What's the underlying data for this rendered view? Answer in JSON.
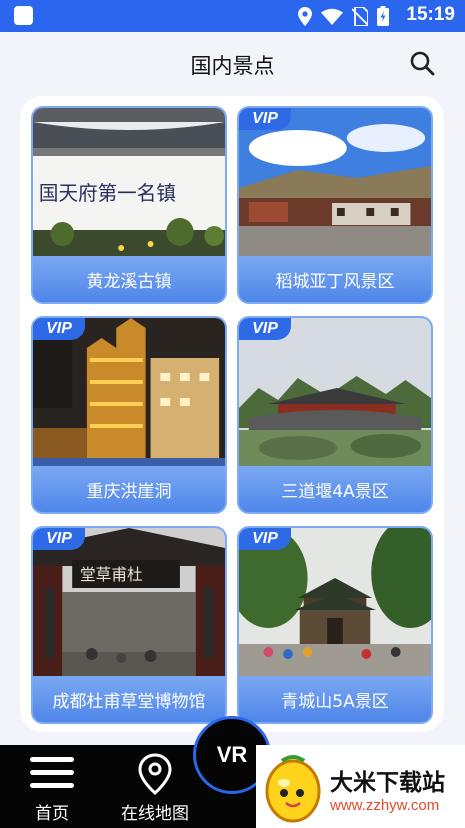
{
  "status_bar": {
    "time": "15:19",
    "icons": [
      "location-icon",
      "wifi-icon",
      "no-sim-icon",
      "battery-icon"
    ]
  },
  "header": {
    "title": "国内景点",
    "search_icon": "search-icon"
  },
  "spots": [
    {
      "name": "黄龙溪古镇",
      "vip": ""
    },
    {
      "name": "稻城亚丁风景区",
      "vip": "VIP"
    },
    {
      "name": "重庆洪崖洞",
      "vip": "VIP"
    },
    {
      "name": "三道堰4A景区",
      "vip": "VIP"
    },
    {
      "name": "成都杜甫草堂博物馆",
      "vip": "VIP"
    },
    {
      "name": "青城山5A景区",
      "vip": "VIP"
    }
  ],
  "bottom_nav": {
    "home_label": "首页",
    "map_label": "在线地图",
    "vr_label": "VR"
  },
  "watermark": {
    "title": "大米下载站",
    "url": "www.zzhyw.com"
  },
  "colors": {
    "accent": "#2a66ee",
    "caption": "#5b8fec",
    "nav_bg": "#050505"
  }
}
